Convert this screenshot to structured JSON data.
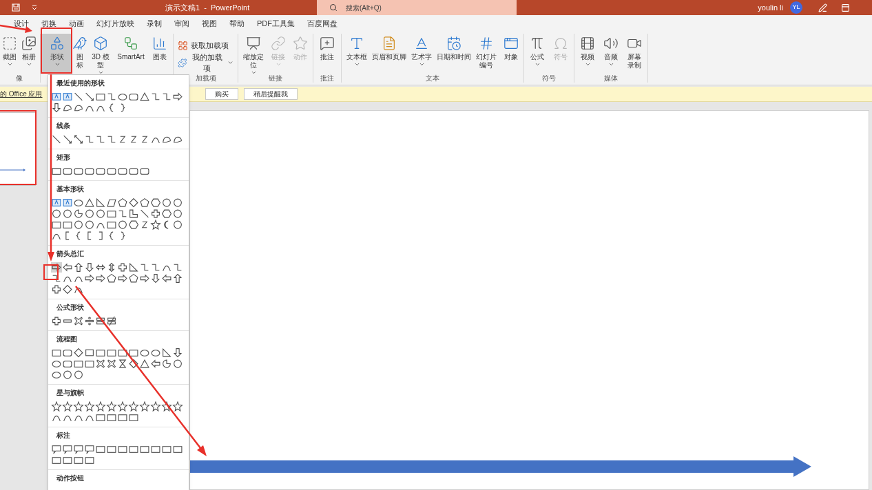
{
  "title_bar": {
    "title": "演示文稿1  -  PowerPoint",
    "search": {
      "placeholder": "搜索(Alt+Q)"
    },
    "user": "youlin li",
    "avatar": "YL"
  },
  "tabs": [
    {
      "label": "设计",
      "selected": false
    },
    {
      "label": "切换",
      "selected": false
    },
    {
      "label": "动画",
      "selected": false
    },
    {
      "label": "幻灯片放映",
      "selected": false
    },
    {
      "label": "录制",
      "selected": false
    },
    {
      "label": "审阅",
      "selected": false
    },
    {
      "label": "视图",
      "selected": false
    },
    {
      "label": "帮助",
      "selected": false
    },
    {
      "label": "PDF工具集",
      "selected": false
    },
    {
      "label": "百度网盘",
      "selected": false
    }
  ],
  "ribbon": {
    "groups": [
      {
        "label": "像",
        "buttons": [
          {
            "kind": "screenshot",
            "label": "截图",
            "dropdown": true,
            "pressed": false,
            "disabled": false
          },
          {
            "kind": "album",
            "label": "相册",
            "dropdown": true,
            "pressed": false,
            "disabled": false
          }
        ]
      },
      {
        "buttons": [
          {
            "kind": "shapes",
            "label": "形状",
            "dropdown": true,
            "pressed": true,
            "disabled": false
          },
          {
            "kind": "icons",
            "label": "图标",
            "dropdown": false,
            "pressed": false,
            "disabled": false
          },
          {
            "kind": "model3d",
            "label": "3D 模型",
            "dropdown": true,
            "pressed": false,
            "disabled": false
          },
          {
            "kind": "smartart",
            "label": "SmartArt",
            "dropdown": false,
            "pressed": false,
            "disabled": false
          },
          {
            "kind": "chart",
            "label": "图表",
            "dropdown": false,
            "pressed": false,
            "disabled": false
          }
        ]
      },
      {
        "label": "加载项",
        "buttons": [
          {
            "kind": "get-addins",
            "label": "获取加载项",
            "dropdown": false,
            "pressed": false,
            "disabled": false
          },
          {
            "kind": "my-addins",
            "label": "我的加载项",
            "dropdown": true,
            "pressed": false,
            "disabled": false
          }
        ]
      },
      {
        "label": "链接",
        "buttons": [
          {
            "kind": "zoom",
            "label": "缩放定位",
            "dropdown": true,
            "pressed": false,
            "disabled": false
          },
          {
            "kind": "link",
            "label": "链接",
            "dropdown": true,
            "pressed": false,
            "disabled": true
          },
          {
            "kind": "action",
            "label": "动作",
            "dropdown": false,
            "pressed": false,
            "disabled": true
          }
        ]
      },
      {
        "label": "批注",
        "buttons": [
          {
            "kind": "comment",
            "label": "批注",
            "dropdown": false,
            "pressed": false,
            "disabled": false
          }
        ]
      },
      {
        "label": "文本",
        "buttons": [
          {
            "kind": "textbox",
            "label": "文本框",
            "dropdown": true,
            "pressed": false,
            "disabled": false
          },
          {
            "kind": "header",
            "label": "页眉和页脚",
            "dropdown": false,
            "pressed": false,
            "disabled": false
          },
          {
            "kind": "wordart",
            "label": "艺术字",
            "dropdown": true,
            "pressed": false,
            "disabled": false
          },
          {
            "kind": "datetime",
            "label": "日期和时间",
            "dropdown": false,
            "pressed": false,
            "disabled": false
          },
          {
            "kind": "slidenum",
            "label": "幻灯片编号",
            "dropdown": false,
            "pressed": false,
            "disabled": false
          },
          {
            "kind": "object",
            "label": "对象",
            "dropdown": false,
            "pressed": false,
            "disabled": false
          }
        ]
      },
      {
        "label": "符号",
        "buttons": [
          {
            "kind": "equation",
            "label": "公式",
            "dropdown": true,
            "pressed": false,
            "disabled": false
          },
          {
            "kind": "symbol",
            "label": "符号",
            "dropdown": false,
            "pressed": false,
            "disabled": true
          }
        ]
      },
      {
        "label": "媒体",
        "buttons": [
          {
            "kind": "video",
            "label": "视频",
            "dropdown": true,
            "pressed": false,
            "disabled": false
          },
          {
            "kind": "audio",
            "label": "音频",
            "dropdown": true,
            "pressed": false,
            "disabled": false
          },
          {
            "kind": "record",
            "label": "屏幕录制",
            "dropdown": false,
            "pressed": false,
            "disabled": false
          }
        ]
      }
    ]
  },
  "message_bar": {
    "link": "的 Office 应用",
    "buttons": [
      "购买",
      "稍后提醒我"
    ]
  },
  "shapes_menu": {
    "sections": [
      {
        "kind": "recent",
        "title": "最近使用的形状"
      },
      {
        "kind": "lines",
        "title": "线条"
      },
      {
        "kind": "rectangles",
        "title": "矩形"
      },
      {
        "kind": "basic",
        "title": "基本形状"
      },
      {
        "kind": "arrows",
        "title": "箭头总汇",
        "highlight_first": true
      },
      {
        "kind": "equation",
        "title": "公式形状"
      },
      {
        "kind": "flowchart",
        "title": "流程图"
      },
      {
        "kind": "stars",
        "title": "星与旗帜"
      },
      {
        "kind": "callouts",
        "title": "标注"
      },
      {
        "kind": "actions",
        "title": "动作按钮"
      }
    ]
  }
}
